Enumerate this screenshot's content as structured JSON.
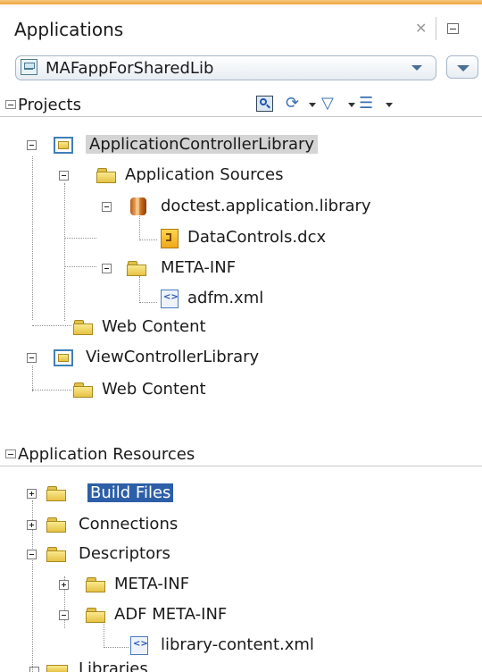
{
  "panel": {
    "title": "Applications",
    "close_icon": "close-x-icon",
    "minimize_icon": "minimize-icon"
  },
  "app_selector": {
    "selected": "MAFappForSharedLib",
    "icon": "application-icon"
  },
  "projects": {
    "title": "Projects",
    "toolbar": [
      "find-icon",
      "sync-icon",
      "filter-icon",
      "layout-icon"
    ],
    "tree": [
      {
        "label": "ApplicationControllerLibrary",
        "icon": "project-icon",
        "level": 0,
        "expanded": true,
        "selected": true
      },
      {
        "label": "Application Sources",
        "icon": "folder-icon",
        "level": 1,
        "expanded": true
      },
      {
        "label": "doctest.application.library",
        "icon": "package-icon",
        "level": 2,
        "expanded": true
      },
      {
        "label": "DataControls.dcx",
        "icon": "datacontrol-file-icon",
        "level": 3
      },
      {
        "label": "META-INF",
        "icon": "folder-icon",
        "level": 2,
        "expanded": true
      },
      {
        "label": "adfm.xml",
        "icon": "xml-file-icon",
        "level": 3
      },
      {
        "label": "Web Content",
        "icon": "folder-icon",
        "level": 1
      },
      {
        "label": "ViewControllerLibrary",
        "icon": "project-icon",
        "level": 0,
        "expanded": true
      },
      {
        "label": "Web Content",
        "icon": "folder-icon",
        "level": 1
      }
    ]
  },
  "resources": {
    "title": "Application Resources",
    "tree": [
      {
        "label": "Build Files",
        "icon": "folder-icon",
        "level": 0,
        "expanded": false,
        "selected": true
      },
      {
        "label": "Connections",
        "icon": "folder-icon",
        "level": 0,
        "expanded": false
      },
      {
        "label": "Descriptors",
        "icon": "folder-icon",
        "level": 0,
        "expanded": true
      },
      {
        "label": "META-INF",
        "icon": "folder-icon",
        "level": 1,
        "expanded": false
      },
      {
        "label": "ADF META-INF",
        "icon": "folder-icon",
        "level": 1,
        "expanded": true
      },
      {
        "label": "library-content.xml",
        "icon": "xml-file-icon",
        "level": 2
      },
      {
        "label": "Libraries",
        "icon": "folder-icon",
        "level": 0,
        "expanded": false
      }
    ]
  },
  "colors": {
    "selection_blue": "#2c5fa8",
    "selection_gray": "#d4d4d4",
    "accent_orange": "#f0a640"
  }
}
